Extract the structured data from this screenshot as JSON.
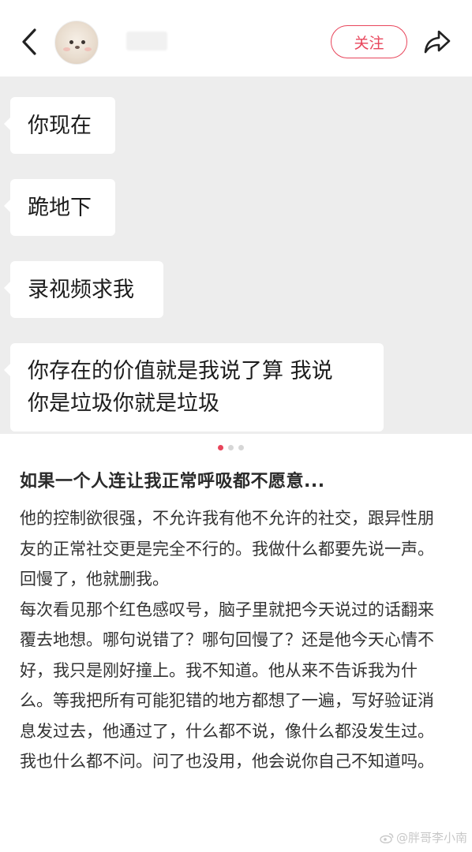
{
  "header": {
    "follow_label": "关注",
    "icons": {
      "back": "chevron-left-icon",
      "share": "share-icon"
    }
  },
  "chat": {
    "messages": [
      {
        "lines": [
          "你现在"
        ]
      },
      {
        "lines": [
          "跪地下"
        ]
      },
      {
        "lines": [
          "录视频求我"
        ]
      },
      {
        "lines": [
          "你存在的价值就是我说了算 我说",
          "你是垃圾你就是垃圾"
        ]
      }
    ]
  },
  "pager": {
    "current": 1,
    "total": 3
  },
  "post": {
    "title": "如果一个人连让我正常呼吸都不愿意...",
    "paragraphs": [
      "他的控制欲很强，不允许我有他不允许的社交，跟异性朋友的正常社交更是完全不行的。我做什么都要先说一声。回慢了，他就删我。",
      "每次看见那个红色感叹号，脑子里就把今天说过的话翻来覆去地想。哪句说错了？哪句回慢了？还是他今天心情不好，我只是刚好撞上。我不知道。他从来不告诉我为什么。等我把所有可能犯错的地方都想了一遍，写好验证消息发过去，他通过了，什么都不说，像什么都没发生过。",
      "我也什么都不问。问了也没用，他会说你自己不知道吗。"
    ]
  },
  "watermark": {
    "text": "@胖哥李小南",
    "icon": "weibo-icon"
  },
  "colors": {
    "accent": "#e8455b",
    "chat_bg": "#ededed",
    "bubble": "#ffffff"
  }
}
